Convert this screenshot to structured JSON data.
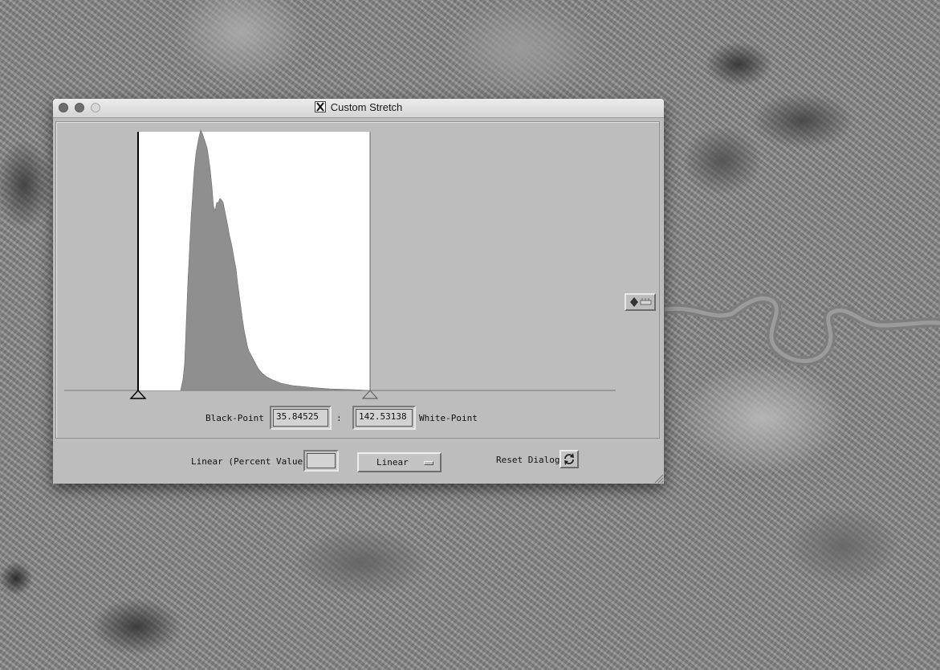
{
  "window": {
    "title": "Custom Stretch",
    "title_icon": "x11-icon"
  },
  "histogram": {
    "black_point_marker": "triangle-marker",
    "white_point_marker": "triangle-marker"
  },
  "stretch": {
    "black_point_label": "Black-Point",
    "black_point_value": "35.84525",
    "separator": ":",
    "white_point_value": "142.53138",
    "white_point_label": "White-Point"
  },
  "controls": {
    "linear_percent_label": "Linear (Percent Value)",
    "linear_percent_value": "",
    "stretch_type_selected": "Linear",
    "reset_label": "Reset Dialog",
    "reset_icon": "refresh-icon",
    "scroll_icon": "diamond-arrows-icon"
  }
}
